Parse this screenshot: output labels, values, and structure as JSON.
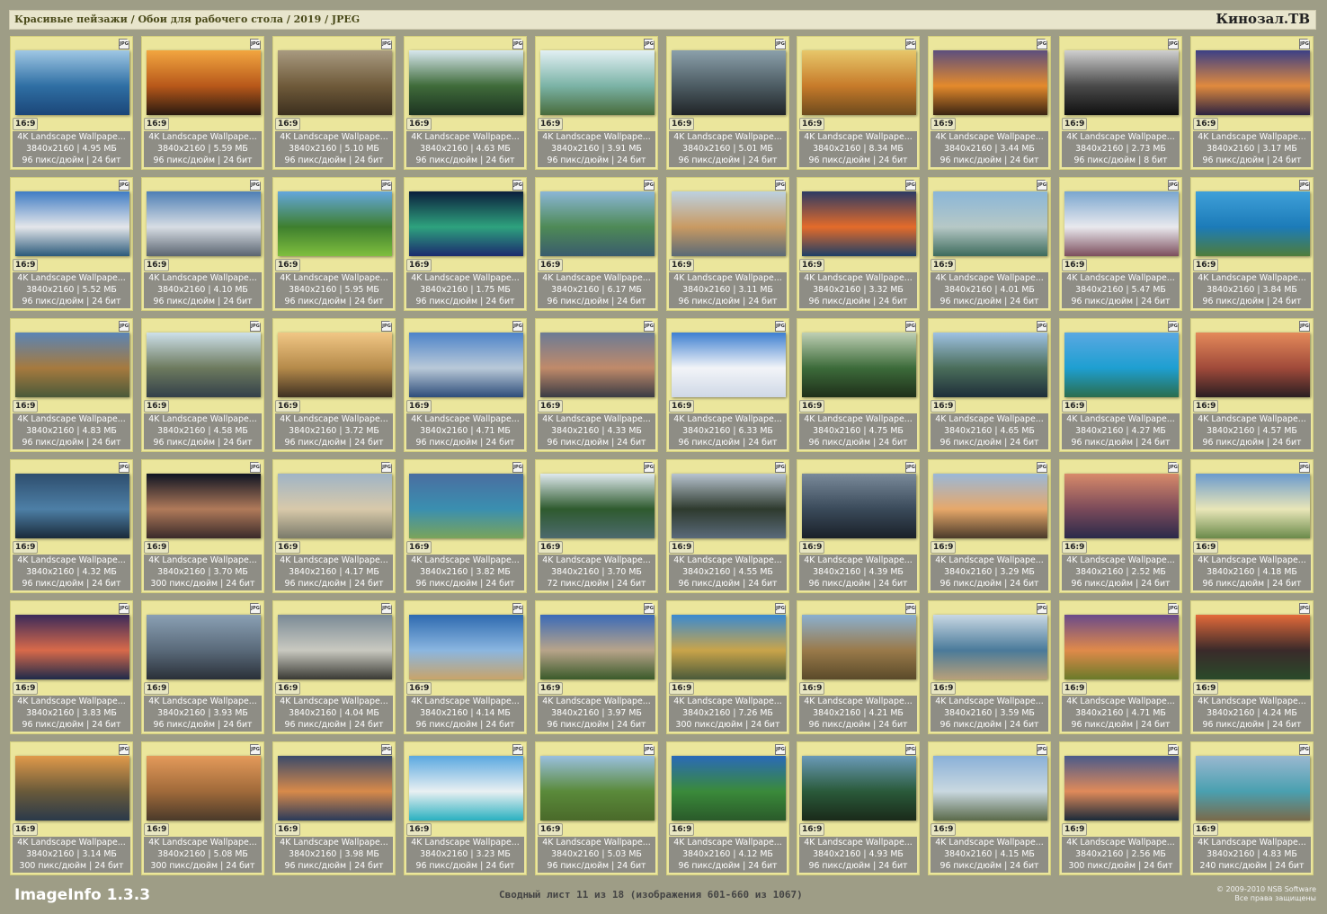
{
  "header": {
    "breadcrumb": "Красивые пейзажи / Обои для рабочего стола / 2019 / JPEG",
    "brand": "Кинозал.ТВ"
  },
  "common": {
    "ratio": "16:9",
    "title": "4K Landscape Wallpape...",
    "file_badge": "JPG"
  },
  "items": [
    {
      "size": "3840x2160 | 4.95 МБ",
      "meta": "96 пикс/дюйм | 24 бит",
      "colors": [
        "#9fc7e4",
        "#2f6fa4",
        "#1b4678"
      ]
    },
    {
      "size": "3840x2160 | 5.59 МБ",
      "meta": "96 пикс/дюйм | 24 бит",
      "colors": [
        "#f2a640",
        "#b8581a",
        "#2a1a10"
      ]
    },
    {
      "size": "3840x2160 | 5.10 МБ",
      "meta": "96 пикс/дюйм | 24 бит",
      "colors": [
        "#a89a80",
        "#6f5a3a",
        "#3c2f1e"
      ]
    },
    {
      "size": "3840x2160 | 4.63 МБ",
      "meta": "96 пикс/дюйм | 24 бит",
      "colors": [
        "#d7e7ee",
        "#3f6b3a",
        "#1d3321"
      ]
    },
    {
      "size": "3840x2160 | 3.91 МБ",
      "meta": "96 пикс/дюйм | 24 бит",
      "colors": [
        "#e2f0f4",
        "#7bb3a6",
        "#486b3b"
      ]
    },
    {
      "size": "3840x2160 | 5.01 МБ",
      "meta": "96 пикс/дюйм | 24 бит",
      "colors": [
        "#8ba0ab",
        "#4d5c63",
        "#202427"
      ]
    },
    {
      "size": "3840x2160 | 8.34 МБ",
      "meta": "96 пикс/дюйм | 24 бит",
      "colors": [
        "#e7c76a",
        "#c77b2a",
        "#6d4a1d"
      ]
    },
    {
      "size": "3840x2160 | 3.44 МБ",
      "meta": "96 пикс/дюйм | 24 бит",
      "colors": [
        "#5c4e7e",
        "#e48a2c",
        "#3b2412"
      ]
    },
    {
      "size": "3840x2160 | 2.73 МБ",
      "meta": "96 пикс/дюйм | 8 бит",
      "colors": [
        "#cfcfcf",
        "#4a4a4a",
        "#101010"
      ]
    },
    {
      "size": "3840x2160 | 3.17 МБ",
      "meta": "96 пикс/дюйм | 24 бит",
      "colors": [
        "#3b3f86",
        "#e08a3e",
        "#2c2240"
      ]
    },
    {
      "size": "3840x2160 | 5.52 МБ",
      "meta": "96 пикс/дюйм | 24 бит",
      "colors": [
        "#3f7cc4",
        "#e4e6ea",
        "#2b5a7a"
      ]
    },
    {
      "size": "3840x2160 | 4.10 МБ",
      "meta": "96 пикс/дюйм | 24 бит",
      "colors": [
        "#4e7fb5",
        "#d7dde4",
        "#5a6470"
      ]
    },
    {
      "size": "3840x2160 | 5.95 МБ",
      "meta": "96 пикс/дюйм | 24 бит",
      "colors": [
        "#64a7dd",
        "#3e7f2e",
        "#7fbf3e"
      ]
    },
    {
      "size": "3840x2160 | 1.75 МБ",
      "meta": "96 пикс/дюйм | 24 бит",
      "colors": [
        "#0b1e3c",
        "#2ea27e",
        "#1b2a6e"
      ]
    },
    {
      "size": "3840x2160 | 6.17 МБ",
      "meta": "96 пикс/дюйм | 24 бит",
      "colors": [
        "#8bb6d6",
        "#4e8a56",
        "#3a5c6d"
      ]
    },
    {
      "size": "3840x2160 | 3.11 МБ",
      "meta": "96 пикс/дюйм | 24 бит",
      "colors": [
        "#bcd1e0",
        "#c99a62",
        "#5a6a76"
      ]
    },
    {
      "size": "3840x2160 | 3.32 МБ",
      "meta": "96 пикс/дюйм | 24 бит",
      "colors": [
        "#2c3a64",
        "#e46b2a",
        "#1e3f66"
      ]
    },
    {
      "size": "3840x2160 | 4.01 МБ",
      "meta": "96 пикс/дюйм | 24 бит",
      "colors": [
        "#8ab6d8",
        "#b6c8c6",
        "#3d6b5c"
      ]
    },
    {
      "size": "3840x2160 | 5.47 МБ",
      "meta": "96 пикс/дюйм | 24 бит",
      "colors": [
        "#7aa6cf",
        "#e9e9ee",
        "#7c4e5d"
      ]
    },
    {
      "size": "3840x2160 | 3.84 МБ",
      "meta": "96 пикс/дюйм | 24 бит",
      "colors": [
        "#3fa0d9",
        "#1c7bb8",
        "#4f7d3a"
      ]
    },
    {
      "size": "3840x2160 | 4.83 МБ",
      "meta": "96 пикс/дюйм | 24 бит",
      "colors": [
        "#5a84b5",
        "#a67a3e",
        "#4a5a3a"
      ]
    },
    {
      "size": "3840x2160 | 4.58 МБ",
      "meta": "96 пикс/дюйм | 24 бит",
      "colors": [
        "#cde0ea",
        "#6d7a5e",
        "#33404a"
      ]
    },
    {
      "size": "3840x2160 | 3.72 МБ",
      "meta": "96 пикс/дюйм | 24 бит",
      "colors": [
        "#f1c785",
        "#b58a4a",
        "#3e3022"
      ]
    },
    {
      "size": "3840x2160 | 4.71 МБ",
      "meta": "96 пикс/дюйм | 24 бит",
      "colors": [
        "#4d83c9",
        "#b9c9d8",
        "#2e4d7a"
      ]
    },
    {
      "size": "3840x2160 | 4.33 МБ",
      "meta": "96 пикс/дюйм | 24 бит",
      "colors": [
        "#6c7b95",
        "#c08a6a",
        "#3a3b44"
      ]
    },
    {
      "size": "3840x2160 | 6.33 МБ",
      "meta": "96 пикс/дюйм | 24 бит",
      "colors": [
        "#3d7fd0",
        "#f2f4f8",
        "#cfd8e6"
      ]
    },
    {
      "size": "3840x2160 | 4.75 МБ",
      "meta": "96 пикс/дюйм | 24 бит",
      "colors": [
        "#bfcfb4",
        "#3c6b3a",
        "#1f2f1a"
      ]
    },
    {
      "size": "3840x2160 | 4.65 МБ",
      "meta": "96 пикс/дюйм | 24 бит",
      "colors": [
        "#9fc2e3",
        "#4a6d5a",
        "#1e2e3a"
      ]
    },
    {
      "size": "3840x2160 | 4.27 МБ",
      "meta": "96 пикс/дюйм | 24 бит",
      "colors": [
        "#5aa8e2",
        "#1e9fd1",
        "#2a6d4e"
      ]
    },
    {
      "size": "3840x2160 | 4.57 МБ",
      "meta": "96 пикс/дюйм | 24 бит",
      "colors": [
        "#e48a5a",
        "#a04a3a",
        "#2a1e22"
      ]
    },
    {
      "size": "3840x2160 | 4.32 МБ",
      "meta": "96 пикс/дюйм | 24 бит",
      "colors": [
        "#2e4e6e",
        "#4d7fa6",
        "#1a2a3a"
      ]
    },
    {
      "size": "3840x2160 | 3.70 МБ",
      "meta": "300 пикс/дюйм | 24 бит",
      "colors": [
        "#0e1422",
        "#b07a5a",
        "#3a2a2a"
      ]
    },
    {
      "size": "3840x2160 | 4.17 МБ",
      "meta": "96 пикс/дюйм | 24 бит",
      "colors": [
        "#9fb4c6",
        "#d8c9aa",
        "#7a7a6a"
      ]
    },
    {
      "size": "3840x2160 | 3.82 МБ",
      "meta": "96 пикс/дюйм | 24 бит",
      "colors": [
        "#4a6ea0",
        "#3a8fb0",
        "#7aa45a"
      ]
    },
    {
      "size": "3840x2160 | 3.70 МБ",
      "meta": "72 пикс/дюйм | 24 бит",
      "colors": [
        "#dfe9ee",
        "#2e5a2e",
        "#4d6a6e"
      ]
    },
    {
      "size": "3840x2160 | 4.55 МБ",
      "meta": "96 пикс/дюйм | 24 бит",
      "colors": [
        "#b8c4d0",
        "#2e3a2e",
        "#5a6a7a"
      ]
    },
    {
      "size": "3840x2160 | 4.39 МБ",
      "meta": "96 пикс/дюйм | 24 бит",
      "colors": [
        "#7a8a9a",
        "#3a4a5a",
        "#1a2028"
      ]
    },
    {
      "size": "3840x2160 | 3.29 МБ",
      "meta": "96 пикс/дюйм | 24 бит",
      "colors": [
        "#9ab8d8",
        "#e7a86a",
        "#4a3a2a"
      ]
    },
    {
      "size": "3840x2160 | 2.52 МБ",
      "meta": "96 пикс/дюйм | 24 бит",
      "colors": [
        "#d88a6a",
        "#7a4a5a",
        "#2a2a4a"
      ]
    },
    {
      "size": "3840x2160 | 4.18 МБ",
      "meta": "96 пикс/дюйм | 24 бит",
      "colors": [
        "#6a9ace",
        "#e9e6b8",
        "#6a8a4a"
      ]
    },
    {
      "size": "3840x2160 | 3.83 МБ",
      "meta": "96 пикс/дюйм | 24 бит",
      "colors": [
        "#3a2a5a",
        "#d86a4a",
        "#1e2a4a"
      ]
    },
    {
      "size": "3840x2160 | 3.93 МБ",
      "meta": "96 пикс/дюйм | 24 бит",
      "colors": [
        "#8aa0b4",
        "#5a6a7a",
        "#2a3038"
      ]
    },
    {
      "size": "3840x2160 | 4.04 МБ",
      "meta": "96 пикс/дюйм | 24 бит",
      "colors": [
        "#7a8a96",
        "#c9c9c0",
        "#3a3a34"
      ]
    },
    {
      "size": "3840x2160 | 4.14 МБ",
      "meta": "96 пикс/дюйм | 24 бит",
      "colors": [
        "#2e6ab0",
        "#8ab6e0",
        "#c9a46a"
      ]
    },
    {
      "size": "3840x2160 | 3.97 МБ",
      "meta": "96 пикс/дюйм | 24 бит",
      "colors": [
        "#3a6ab8",
        "#b8a48a",
        "#3a5a2a"
      ]
    },
    {
      "size": "3840x2160 | 7.26 МБ",
      "meta": "300 пикс/дюйм | 24 бит",
      "colors": [
        "#3a8ad0",
        "#c9a44a",
        "#4a5a3a"
      ]
    },
    {
      "size": "3840x2160 | 4.21 МБ",
      "meta": "96 пикс/дюйм | 24 бит",
      "colors": [
        "#8ab0d0",
        "#9a7a4a",
        "#5a4a2a"
      ]
    },
    {
      "size": "3840x2160 | 3.59 МБ",
      "meta": "96 пикс/дюйм | 24 бит",
      "colors": [
        "#c9d8e4",
        "#4a7a9a",
        "#b8a07a"
      ]
    },
    {
      "size": "3840x2160 | 4.71 МБ",
      "meta": "96 пикс/дюйм | 24 бит",
      "colors": [
        "#6a4a8a",
        "#e08a4a",
        "#6a7a2a"
      ]
    },
    {
      "size": "3840x2160 | 4.24 МБ",
      "meta": "96 пикс/дюйм | 24 бит",
      "colors": [
        "#e46a3a",
        "#3a2a2a",
        "#2a4a2a"
      ]
    },
    {
      "size": "3840x2160 | 3.14 МБ",
      "meta": "300 пикс/дюйм | 24 бит",
      "colors": [
        "#e09a4a",
        "#6a5a3a",
        "#2a3a4a"
      ]
    },
    {
      "size": "3840x2160 | 5.08 МБ",
      "meta": "300 пикс/дюйм | 24 бит",
      "colors": [
        "#e49a5a",
        "#a06a3a",
        "#4a3a2a"
      ]
    },
    {
      "size": "3840x2160 | 3.98 МБ",
      "meta": "96 пикс/дюйм | 24 бит",
      "colors": [
        "#3a4a6a",
        "#d88a4a",
        "#2a3a5a"
      ]
    },
    {
      "size": "3840x2160 | 3.23 МБ",
      "meta": "96 пикс/дюйм | 24 бит",
      "colors": [
        "#5aa8e0",
        "#e9f0f2",
        "#2ab0c0"
      ]
    },
    {
      "size": "3840x2160 | 5.03 МБ",
      "meta": "96 пикс/дюйм | 24 бит",
      "colors": [
        "#9ac0e0",
        "#5a8a3a",
        "#4a6a2a"
      ]
    },
    {
      "size": "3840x2160 | 4.12 МБ",
      "meta": "96 пикс/дюйм | 24 бит",
      "colors": [
        "#2a6ab8",
        "#3a8a3a",
        "#2a5a2a"
      ]
    },
    {
      "size": "3840x2160 | 4.93 МБ",
      "meta": "96 пикс/дюйм | 24 бит",
      "colors": [
        "#6a9ab8",
        "#2a5a3a",
        "#1a2a1a"
      ]
    },
    {
      "size": "3840x2160 | 4.15 МБ",
      "meta": "96 пикс/дюйм | 24 бит",
      "colors": [
        "#8ab0d8",
        "#c9d8e0",
        "#5a6a4a"
      ]
    },
    {
      "size": "3840x2160 | 2.56 МБ",
      "meta": "300 пикс/дюйм | 24 бит",
      "colors": [
        "#4a5a8a",
        "#e08a5a",
        "#1a2a3a"
      ]
    },
    {
      "size": "3840x2160 | 4.83 МБ",
      "meta": "240 пикс/дюйм | 24 бит",
      "colors": [
        "#9ab8d0",
        "#4aa0b0",
        "#7a6a4a"
      ]
    }
  ],
  "footer": {
    "app": "ImageInfo 1.3.3",
    "summary": "Сводный лист 11 из 18 (изображения 601-660 из 1067)",
    "copyright_line1": "© 2009-2010 NSB Software",
    "copyright_line2": "Все права защищены"
  }
}
